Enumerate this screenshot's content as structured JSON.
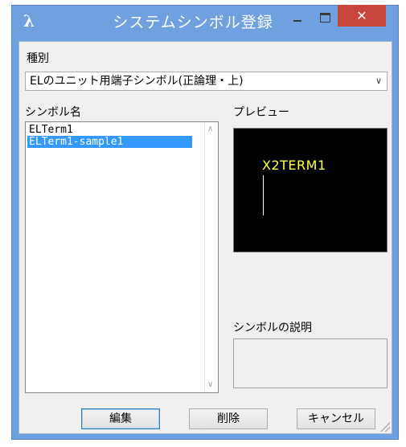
{
  "window": {
    "title": "システムシンボル登録",
    "close_glyph": "✕",
    "app_icon_glyph": "λ"
  },
  "type_section": {
    "label": "種別",
    "selected": "ELのユニット用端子シンボル(正論理・上)",
    "dropdown_glyph": "∨"
  },
  "symbol_list": {
    "label": "シンボル名",
    "items": [
      "ELTerm1",
      "ELTerm1-sample1"
    ],
    "selected_index": 1,
    "scroll_up_glyph": "∧",
    "scroll_down_glyph": "∨"
  },
  "preview": {
    "label": "プレビュー",
    "text": "X2TERM1",
    "background": "#000000",
    "text_color": "#ffff40"
  },
  "description": {
    "label": "シンボルの説明",
    "value": ""
  },
  "buttons": {
    "edit": "編集",
    "delete": "削除",
    "cancel": "キャンセル"
  },
  "colors": {
    "titlebar": "#6fa1e0",
    "close_button": "#c9463d",
    "selection": "#3399ff"
  }
}
